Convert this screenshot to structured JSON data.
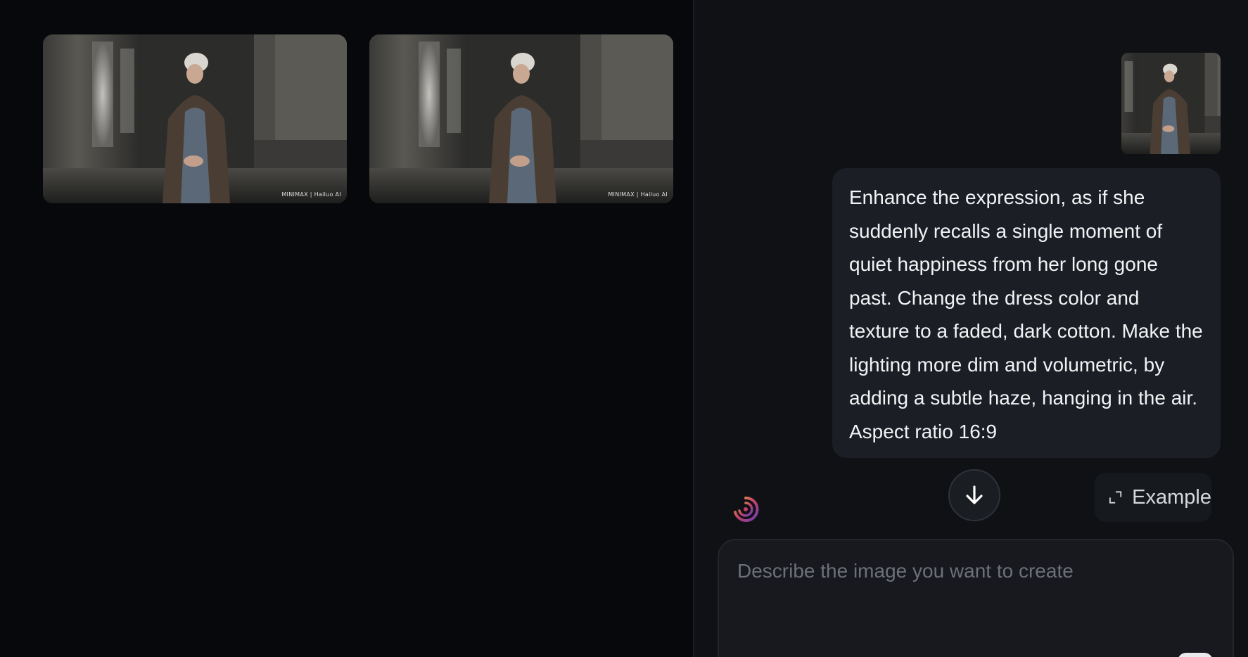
{
  "gallery": {
    "images": [
      {
        "watermark": "MINIMAX | Hailuo AI"
      },
      {
        "watermark": "MINIMAX | Hailuo AI"
      }
    ]
  },
  "chat": {
    "user_message": "Enhance the expression, as if she suddenly recalls a single moment of quiet happiness from her long gone past. Change the dress color and texture to a faded, dark cotton. Make the lighting more dim and volumetric, by adding a subtle haze, hanging in the air. Aspect ratio 16:9",
    "example_button_label": "Example",
    "prompt_placeholder": "Describe the image you want to create"
  },
  "colors": {
    "background": "#07080b",
    "panel": "#0f1115",
    "bubble": "#1b1e24",
    "text": "#f2f3f5",
    "placeholder": "#6c7078"
  },
  "icons": {
    "scroll_down": "arrow-down-icon",
    "example": "expand-icon",
    "assistant": "hailuo-logo-icon"
  }
}
